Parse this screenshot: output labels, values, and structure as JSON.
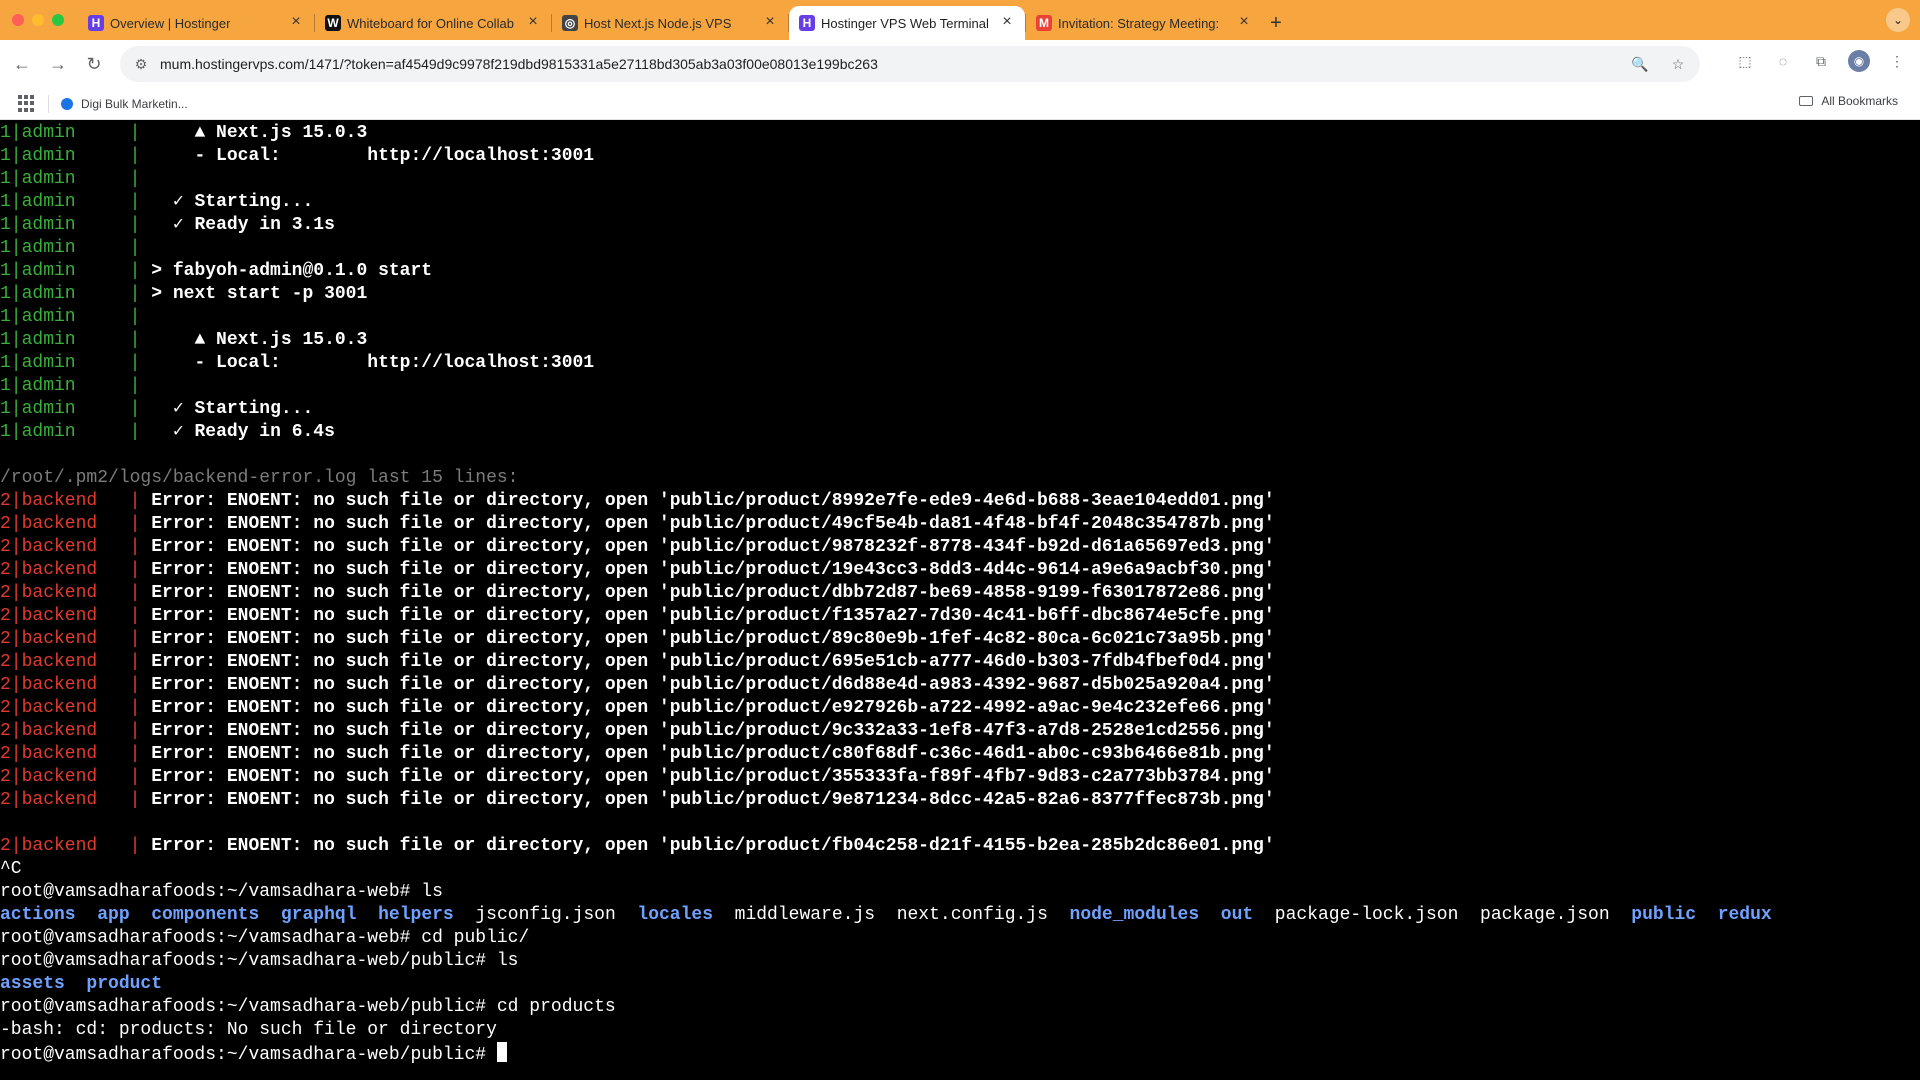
{
  "browser": {
    "tabs": [
      {
        "title": "Overview | Hostinger",
        "favicon": "H",
        "favicon_color": "#673de6",
        "active": false
      },
      {
        "title": "Whiteboard for Online Collab",
        "favicon": "W",
        "favicon_color": "#111111",
        "active": false
      },
      {
        "title": "Host Next.js Node.js VPS",
        "favicon": "◎",
        "favicon_color": "#444444",
        "active": false
      },
      {
        "title": "Hostinger VPS Web Terminal",
        "favicon": "H",
        "favicon_color": "#673de6",
        "active": true
      },
      {
        "title": "Invitation: Strategy Meeting: ",
        "favicon": "M",
        "favicon_color": "#ea4335",
        "active": false
      }
    ],
    "url": "mum.hostingervps.com/1471/?token=af4549d9c9978f219dbd9815331a5e27118bd305ab3a03f00e08013e199bc263",
    "bookmarks": [
      {
        "label": "Digi Bulk Marketin..."
      }
    ],
    "bookmarks_right": "All Bookmarks"
  },
  "terminal": {
    "lines": [
      [
        {
          "t": "1|admin     |",
          "c": "green"
        },
        {
          "t": "     ▲ Next.js 15.0.3",
          "c": "bold"
        }
      ],
      [
        {
          "t": "1|admin     |",
          "c": "green"
        },
        {
          "t": "     - Local:        http://localhost:3001",
          "c": "bold"
        }
      ],
      [
        {
          "t": "1|admin     |",
          "c": "green"
        }
      ],
      [
        {
          "t": "1|admin     |",
          "c": "green"
        },
        {
          "t": "   ✓ Starting...",
          "c": "bold"
        }
      ],
      [
        {
          "t": "1|admin     |",
          "c": "green"
        },
        {
          "t": "   ✓ Ready in 3.1s",
          "c": "bold"
        }
      ],
      [
        {
          "t": "1|admin     |",
          "c": "green"
        }
      ],
      [
        {
          "t": "1|admin     |",
          "c": "green"
        },
        {
          "t": " > fabyoh-admin@0.1.0 start",
          "c": "bold"
        }
      ],
      [
        {
          "t": "1|admin     |",
          "c": "green"
        },
        {
          "t": " > next start -p 3001",
          "c": "bold"
        }
      ],
      [
        {
          "t": "1|admin     |",
          "c": "green"
        }
      ],
      [
        {
          "t": "1|admin     |",
          "c": "green"
        },
        {
          "t": "     ▲ Next.js 15.0.3",
          "c": "bold"
        }
      ],
      [
        {
          "t": "1|admin     |",
          "c": "green"
        },
        {
          "t": "     - Local:        http://localhost:3001",
          "c": "bold"
        }
      ],
      [
        {
          "t": "1|admin     |",
          "c": "green"
        }
      ],
      [
        {
          "t": "1|admin     |",
          "c": "green"
        },
        {
          "t": "   ✓ Starting...",
          "c": "bold"
        }
      ],
      [
        {
          "t": "1|admin     |",
          "c": "green"
        },
        {
          "t": "   ✓ Ready in 6.4s",
          "c": "bold"
        }
      ],
      [],
      [
        {
          "t": "/root/.pm2/logs/backend-error.log last 15 lines:",
          "c": "dim"
        }
      ],
      [
        {
          "t": "2|backend   |",
          "c": "red"
        },
        {
          "t": " Error: ENOENT: no such file or directory, open 'public/product/8992e7fe-ede9-4e6d-b688-3eae104edd01.png'",
          "c": "bold"
        }
      ],
      [
        {
          "t": "2|backend   |",
          "c": "red"
        },
        {
          "t": " Error: ENOENT: no such file or directory, open 'public/product/49cf5e4b-da81-4f48-bf4f-2048c354787b.png'",
          "c": "bold"
        }
      ],
      [
        {
          "t": "2|backend   |",
          "c": "red"
        },
        {
          "t": " Error: ENOENT: no such file or directory, open 'public/product/9878232f-8778-434f-b92d-d61a65697ed3.png'",
          "c": "bold"
        }
      ],
      [
        {
          "t": "2|backend   |",
          "c": "red"
        },
        {
          "t": " Error: ENOENT: no such file or directory, open 'public/product/19e43cc3-8dd3-4d4c-9614-a9e6a9acbf30.png'",
          "c": "bold"
        }
      ],
      [
        {
          "t": "2|backend   |",
          "c": "red"
        },
        {
          "t": " Error: ENOENT: no such file or directory, open 'public/product/dbb72d87-be69-4858-9199-f63017872e86.png'",
          "c": "bold"
        }
      ],
      [
        {
          "t": "2|backend   |",
          "c": "red"
        },
        {
          "t": " Error: ENOENT: no such file or directory, open 'public/product/f1357a27-7d30-4c41-b6ff-dbc8674e5cfe.png'",
          "c": "bold"
        }
      ],
      [
        {
          "t": "2|backend   |",
          "c": "red"
        },
        {
          "t": " Error: ENOENT: no such file or directory, open 'public/product/89c80e9b-1fef-4c82-80ca-6c021c73a95b.png'",
          "c": "bold"
        }
      ],
      [
        {
          "t": "2|backend   |",
          "c": "red"
        },
        {
          "t": " Error: ENOENT: no such file or directory, open 'public/product/695e51cb-a777-46d0-b303-7fdb4fbef0d4.png'",
          "c": "bold"
        }
      ],
      [
        {
          "t": "2|backend   |",
          "c": "red"
        },
        {
          "t": " Error: ENOENT: no such file or directory, open 'public/product/d6d88e4d-a983-4392-9687-d5b025a920a4.png'",
          "c": "bold"
        }
      ],
      [
        {
          "t": "2|backend   |",
          "c": "red"
        },
        {
          "t": " Error: ENOENT: no such file or directory, open 'public/product/e927926b-a722-4992-a9ac-9e4c232efe66.png'",
          "c": "bold"
        }
      ],
      [
        {
          "t": "2|backend   |",
          "c": "red"
        },
        {
          "t": " Error: ENOENT: no such file or directory, open 'public/product/9c332a33-1ef8-47f3-a7d8-2528e1cd2556.png'",
          "c": "bold"
        }
      ],
      [
        {
          "t": "2|backend   |",
          "c": "red"
        },
        {
          "t": " Error: ENOENT: no such file or directory, open 'public/product/c80f68df-c36c-46d1-ab0c-c93b6466e81b.png'",
          "c": "bold"
        }
      ],
      [
        {
          "t": "2|backend   |",
          "c": "red"
        },
        {
          "t": " Error: ENOENT: no such file or directory, open 'public/product/355333fa-f89f-4fb7-9d83-c2a773bb3784.png'",
          "c": "bold"
        }
      ],
      [
        {
          "t": "2|backend   |",
          "c": "red"
        },
        {
          "t": " Error: ENOENT: no such file or directory, open 'public/product/9e871234-8dcc-42a5-82a6-8377ffec873b.png'",
          "c": "bold"
        }
      ],
      [],
      [
        {
          "t": "2|backend   |",
          "c": "red"
        },
        {
          "t": " Error: ENOENT: no such file or directory, open 'public/product/fb04c258-d21f-4155-b2ea-285b2dc86e01.png'",
          "c": "bold"
        }
      ],
      [
        {
          "t": "^C",
          "c": ""
        }
      ],
      [
        {
          "t": "root@vamsadharafoods:~/vamsadhara-web# ls",
          "c": ""
        }
      ],
      [
        {
          "t": "actions",
          "c": "blue"
        },
        {
          "t": "  ",
          "c": ""
        },
        {
          "t": "app",
          "c": "blue"
        },
        {
          "t": "  ",
          "c": ""
        },
        {
          "t": "components",
          "c": "blue"
        },
        {
          "t": "  ",
          "c": ""
        },
        {
          "t": "graphql",
          "c": "blue"
        },
        {
          "t": "  ",
          "c": ""
        },
        {
          "t": "helpers",
          "c": "blue"
        },
        {
          "t": "  ",
          "c": ""
        },
        {
          "t": "jsconfig.json",
          "c": ""
        },
        {
          "t": "  ",
          "c": ""
        },
        {
          "t": "locales",
          "c": "blue"
        },
        {
          "t": "  ",
          "c": ""
        },
        {
          "t": "middleware.js",
          "c": ""
        },
        {
          "t": "  ",
          "c": ""
        },
        {
          "t": "next.config.js",
          "c": ""
        },
        {
          "t": "  ",
          "c": ""
        },
        {
          "t": "node_modules",
          "c": "blue"
        },
        {
          "t": "  ",
          "c": ""
        },
        {
          "t": "out",
          "c": "blue"
        },
        {
          "t": "  ",
          "c": ""
        },
        {
          "t": "package-lock.json",
          "c": ""
        },
        {
          "t": "  ",
          "c": ""
        },
        {
          "t": "package.json",
          "c": ""
        },
        {
          "t": "  ",
          "c": ""
        },
        {
          "t": "public",
          "c": "blue"
        },
        {
          "t": "  ",
          "c": ""
        },
        {
          "t": "redux",
          "c": "blue"
        }
      ],
      [
        {
          "t": "root@vamsadharafoods:~/vamsadhara-web# cd public/",
          "c": ""
        }
      ],
      [
        {
          "t": "root@vamsadharafoods:~/vamsadhara-web/public# ls",
          "c": ""
        }
      ],
      [
        {
          "t": "assets",
          "c": "blue"
        },
        {
          "t": "  ",
          "c": ""
        },
        {
          "t": "product",
          "c": "blue"
        }
      ],
      [
        {
          "t": "root@vamsadharafoods:~/vamsadhara-web/public# cd products",
          "c": ""
        }
      ],
      [
        {
          "t": "-bash: cd: products: No such file or directory",
          "c": ""
        }
      ],
      [
        {
          "t": "root@vamsadharafoods:~/vamsadhara-web/public# ",
          "c": ""
        },
        {
          "cursor": true
        }
      ]
    ]
  },
  "colors": {
    "chrome": "#f6a53f",
    "term_bg": "#000000",
    "term_green": "#38b03a",
    "term_red": "#e23b2e",
    "term_blue": "#6fa1ff"
  }
}
